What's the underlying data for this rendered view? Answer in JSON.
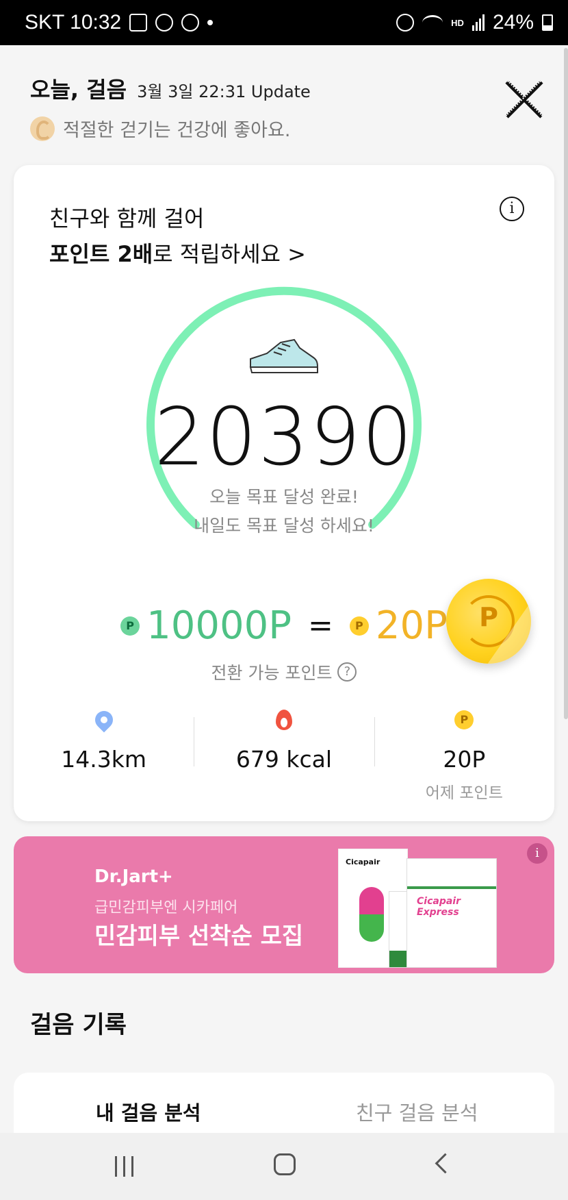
{
  "status_bar": {
    "carrier_time": "SKT 10:32",
    "battery": "24%",
    "icons": [
      "gallery-icon",
      "c-icon",
      "lock-icon",
      "dot-icon",
      "alarm-icon",
      "wifi-icon",
      "hd-voice-icon",
      "signal-icon",
      "battery-icon"
    ],
    "hd_label": "HD"
  },
  "header": {
    "title": "오늘, 걸음",
    "update": "3월 3일 22:31 Update",
    "subtitle": "적절한 걷기는 건강에 좋아요."
  },
  "card": {
    "promo_line1": "친구와 함께 걸어",
    "promo_bold": "포인트 2배",
    "promo_rest": "로 적립하세요 >",
    "info_glyph": "i",
    "steps": "20390",
    "goal_line1": "오늘 목표 달성 완료!",
    "goal_line2": "내일도 목표 달성 하세요!",
    "badge_letter": "P",
    "points_from": "10000P",
    "equals": "=",
    "points_to": "20P",
    "coin_letter": "P",
    "conversion_label": "전환 가능 포인트",
    "help_glyph": "?",
    "stats": {
      "distance": "14.3km",
      "calories": "679 kcal",
      "yesterday_points": "20P",
      "yesterday_label": "어제 포인트"
    },
    "gauge_color": "#7df0b5"
  },
  "banner": {
    "brand": "Dr.Jart+",
    "line1": "급민감피부엔 시카페어",
    "line2": "민감피부 선착순 모집",
    "product_label": "Cicapair",
    "box_label": "Cicapair Express",
    "ad_glyph": "i",
    "bg_color": "#ea7aab"
  },
  "records": {
    "title": "걸음 기록",
    "tab_my": "내 걸음 분석",
    "tab_friend": "친구 걸음 분석"
  }
}
